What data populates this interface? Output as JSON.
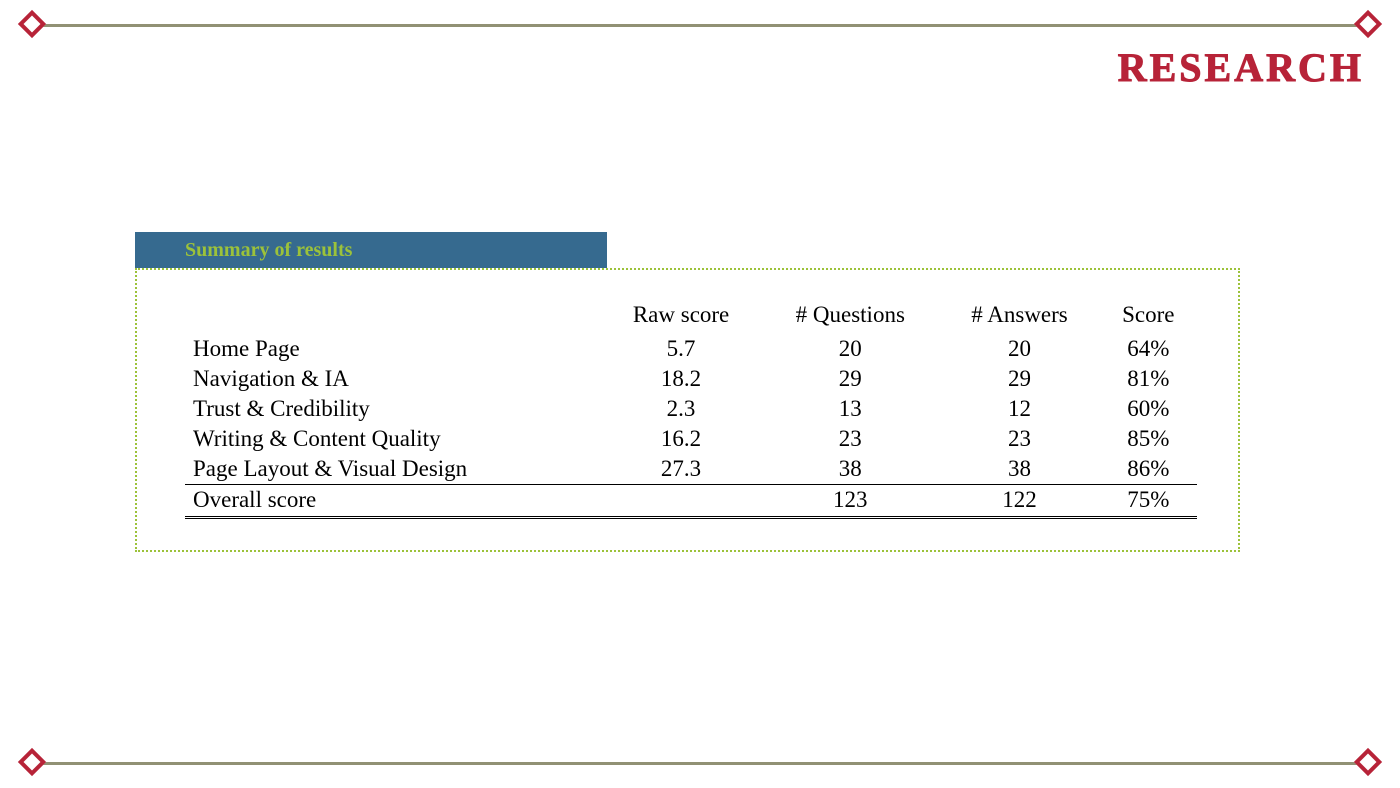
{
  "heading": "RESEARCH",
  "summary_title": "Summary of results",
  "columns": {
    "label": "",
    "raw": "Raw score",
    "questions": "# Questions",
    "answers": "# Answers",
    "score": "Score"
  },
  "rows": [
    {
      "label": "Home Page",
      "raw": "5.7",
      "questions": "20",
      "answers": "20",
      "score": "64%"
    },
    {
      "label": "Navigation & IA",
      "raw": "18.2",
      "questions": "29",
      "answers": "29",
      "score": "81%"
    },
    {
      "label": "Trust & Credibility",
      "raw": "2.3",
      "questions": "13",
      "answers": "12",
      "score": "60%"
    },
    {
      "label": "Writing & Content Quality",
      "raw": "16.2",
      "questions": "23",
      "answers": "23",
      "score": "85%"
    },
    {
      "label": "Page Layout & Visual Design",
      "raw": "27.3",
      "questions": "38",
      "answers": "38",
      "score": "86%"
    }
  ],
  "total": {
    "label": "Overall score",
    "raw": "",
    "questions": "123",
    "answers": "122",
    "score": "75%"
  },
  "chart_data": {
    "type": "table",
    "title": "Summary of results",
    "columns": [
      "",
      "Raw score",
      "# Questions",
      "# Answers",
      "Score"
    ],
    "rows": [
      [
        "Home Page",
        5.7,
        20,
        20,
        "64%"
      ],
      [
        "Navigation & IA",
        18.2,
        29,
        29,
        "81%"
      ],
      [
        "Trust & Credibility",
        2.3,
        13,
        12,
        "60%"
      ],
      [
        "Writing & Content Quality",
        16.2,
        23,
        23,
        "85%"
      ],
      [
        "Page Layout & Visual Design",
        27.3,
        38,
        38,
        "86%"
      ],
      [
        "Overall score",
        null,
        123,
        122,
        "75%"
      ]
    ]
  }
}
